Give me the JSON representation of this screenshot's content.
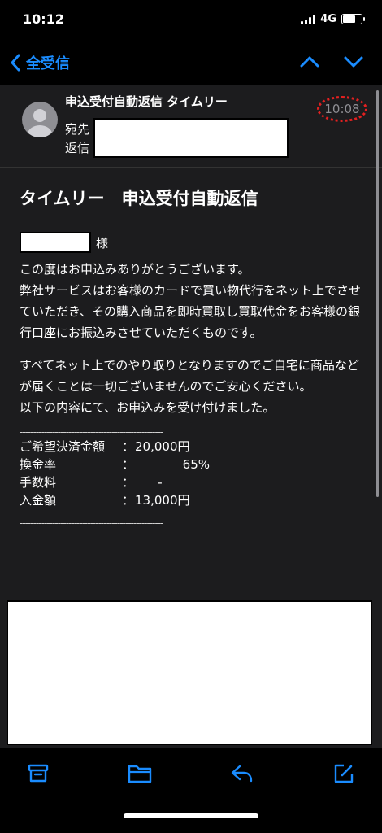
{
  "status_bar": {
    "time": "10:12",
    "network": "4G",
    "battery_level": 0.7
  },
  "nav": {
    "back_label": "全受信",
    "accent_color": "#1a8cff"
  },
  "email": {
    "sender": "申込受付自動返信 タイムリー",
    "time": "10:08",
    "to_label": "宛先",
    "reply_label": "返信",
    "subject": "タイムリー　申込受付自動返信",
    "honorific": "様",
    "paragraphs": [
      "この度はお申込みありがとうございます。\n弊社サービスはお客様のカードで買い物代行をネット上でさせていただき、その購入商品を即時買取し買取代金をお客様の銀行口座にお振込みさせていただくものです。",
      "すべてネット上でのやり取りとなりますのでご自宅に商品などが届くことは一切ございませんのでご安心ください。\n以下の内容にて、お申込みを受け付けました。"
    ],
    "rule": "-----------------------------------------------------",
    "details": [
      {
        "label": "ご希望決済金額",
        "sep": "：",
        "value": "20,000円"
      },
      {
        "label": "換金率",
        "sep": "：",
        "value": "65%"
      },
      {
        "label": "手数料",
        "sep": "：",
        "value": "-"
      },
      {
        "label": "入金額",
        "sep": "：",
        "value": "13,000円"
      }
    ]
  },
  "toolbar": {
    "icons": [
      "archive-icon",
      "folder-icon",
      "reply-icon",
      "compose-icon"
    ]
  }
}
